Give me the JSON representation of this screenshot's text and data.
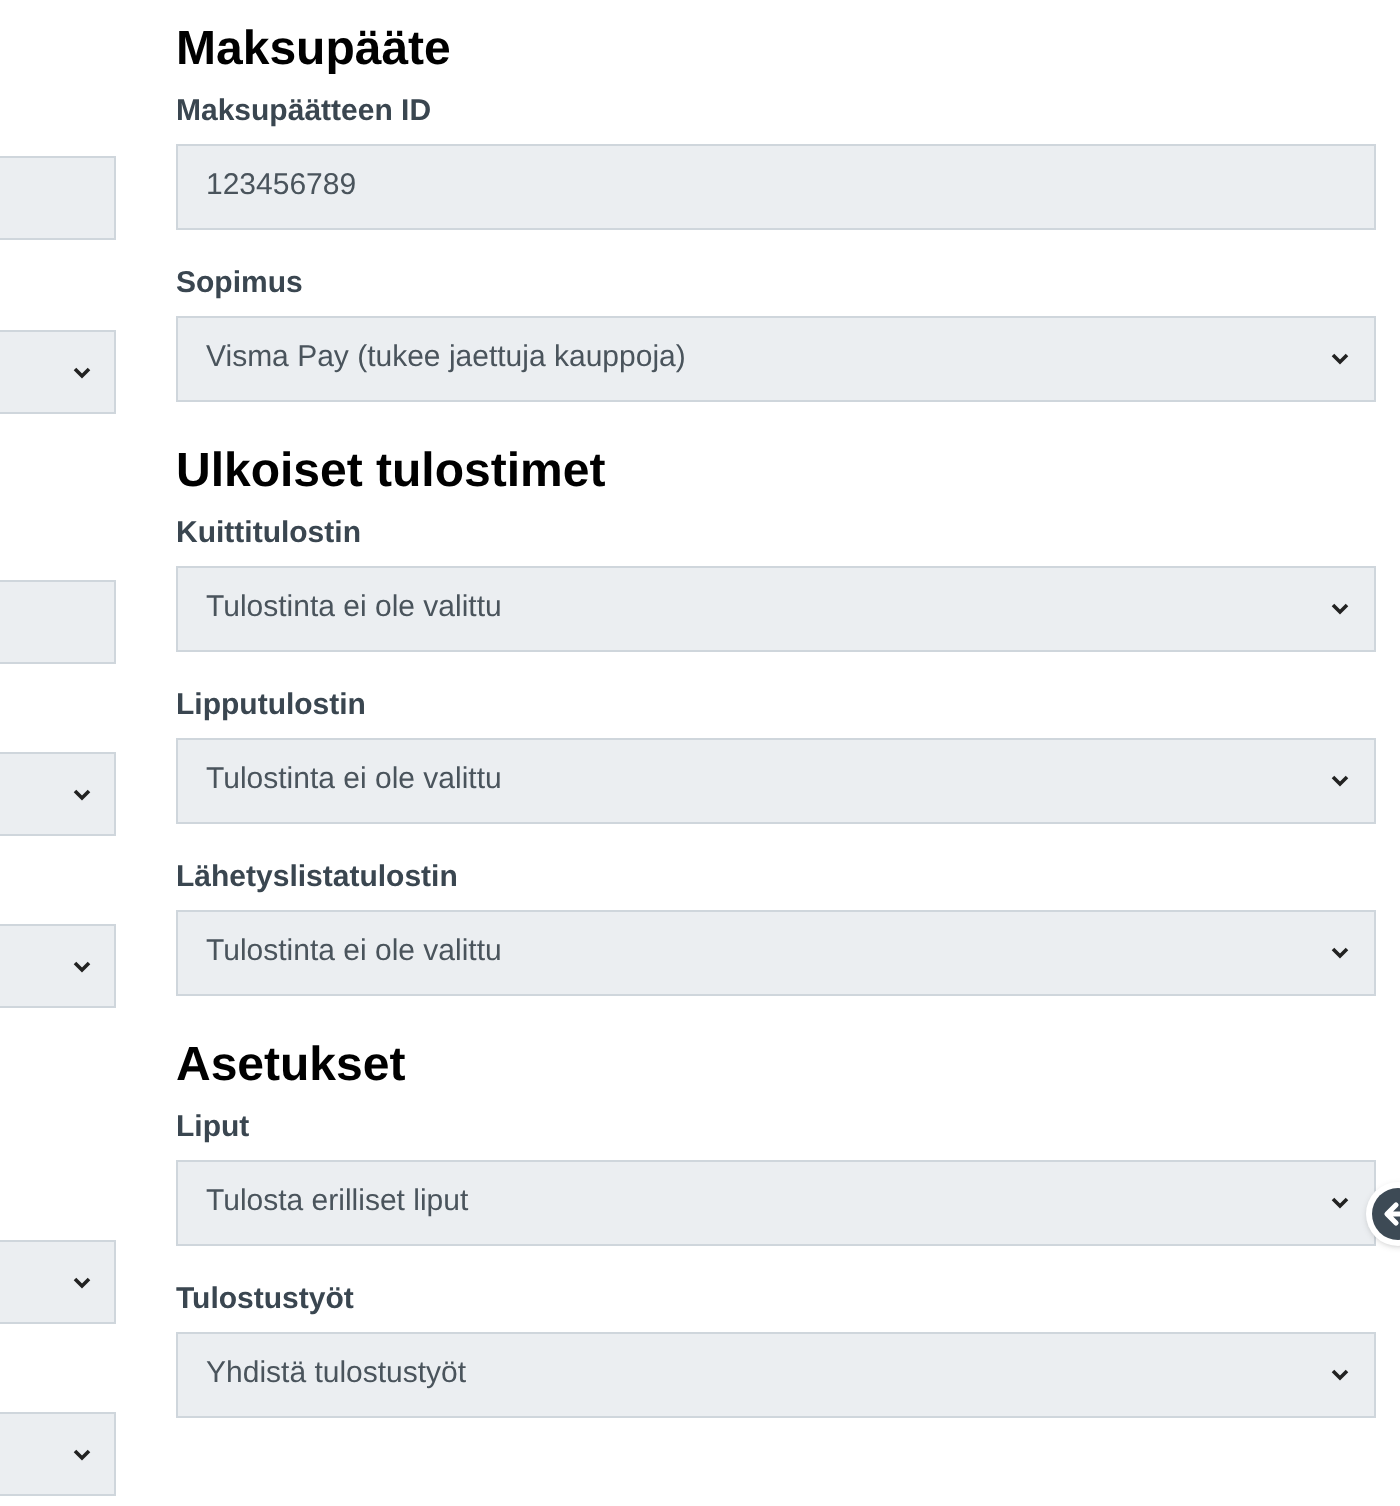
{
  "left_column": {
    "fields": [
      {
        "kind": "input"
      },
      {
        "kind": "select"
      },
      {
        "kind": "input"
      },
      {
        "kind": "select"
      },
      {
        "kind": "select"
      },
      {
        "kind": "select"
      },
      {
        "kind": "select"
      }
    ]
  },
  "sections": [
    {
      "heading": "Maksupääte",
      "fields": [
        {
          "label": "Maksupäätteen ID",
          "kind": "input",
          "value": "123456789"
        },
        {
          "label": "Sopimus",
          "kind": "select",
          "value": "Visma Pay (tukee jaettuja kauppoja)"
        }
      ]
    },
    {
      "heading": "Ulkoiset tulostimet",
      "fields": [
        {
          "label": "Kuittitulostin",
          "kind": "select",
          "value": "Tulostinta ei ole valittu"
        },
        {
          "label": "Lipputulostin",
          "kind": "select",
          "value": "Tulostinta ei ole valittu"
        },
        {
          "label": "Lähetyslistatulostin",
          "kind": "select",
          "value": "Tulostinta ei ole valittu"
        }
      ]
    },
    {
      "heading": "Asetukset",
      "fields": [
        {
          "label": "Liput",
          "kind": "select",
          "value": "Tulosta erilliset liput"
        },
        {
          "label": "Tulostustyöt",
          "kind": "select",
          "value": "Yhdistä tulostustyöt"
        }
      ]
    }
  ]
}
